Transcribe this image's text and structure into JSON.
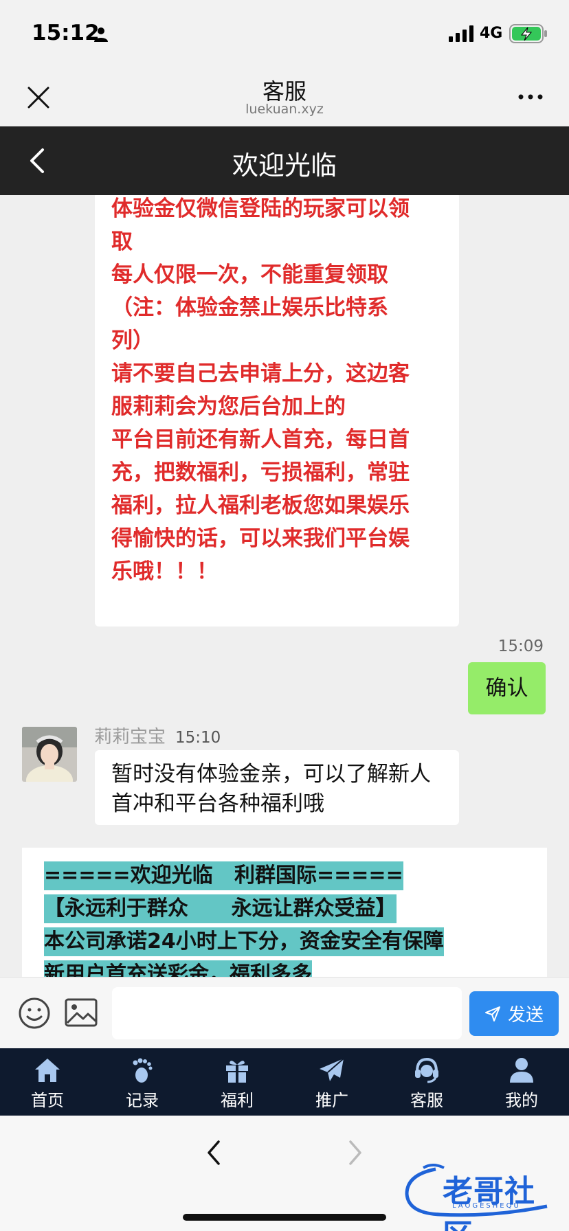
{
  "status_bar": {
    "time": "15:12",
    "network": "4G"
  },
  "webview": {
    "title": "客服",
    "domain": "luekuan.xyz"
  },
  "page": {
    "title": "欢迎光临"
  },
  "chat": {
    "agent_message_lines": [
      "体验金仅微信登陆的玩家可以领",
      "取",
      "每人仅限一次，不能重复领取",
      "（注：体验金禁止娱乐比特系",
      "列）",
      "请不要自己去申请上分，这边客",
      "服莉莉会为您后台加上的",
      "平台目前还有新人首充，每日首",
      "充，把数福利，亏损福利，常驻",
      "福利，拉人福利老板您如果娱乐",
      "得愉快的话，可以来我们平台娱",
      "乐哦！！！"
    ],
    "user_message": {
      "time": "15:09",
      "text": "确认"
    },
    "agent_reply": {
      "sender": "莉莉宝宝",
      "time": "15:10",
      "text": "暂时没有体验金亲，可以了解新人首冲和平台各种福利哦"
    },
    "announcement_lines": [
      "=====欢迎光临   利群国际=====",
      "【永远利于群众      永远让群众受益】",
      "本公司承诺24小时上下分，资金安全有保障",
      "新用户首充送彩金，福利多多"
    ]
  },
  "input_bar": {
    "placeholder": "",
    "send_label": "发送"
  },
  "bottom_nav": {
    "items": [
      {
        "label": "首页",
        "icon": "home-icon"
      },
      {
        "label": "记录",
        "icon": "footprint-icon"
      },
      {
        "label": "福利",
        "icon": "gift-icon"
      },
      {
        "label": "推广",
        "icon": "paper-plane-icon"
      },
      {
        "label": "客服",
        "icon": "headset-icon"
      },
      {
        "label": "我的",
        "icon": "user-icon"
      }
    ]
  },
  "watermark": {
    "text": "老哥社区",
    "sub": "LAOGESHEQU"
  },
  "colors": {
    "title_bar_bg": "#232323",
    "nav_bg": "#0e1a2e",
    "user_bubble": "#95ec69",
    "agent_red_text": "#e02b2b",
    "highlight": "#63c6c5",
    "send_button": "#2f8cf0"
  }
}
